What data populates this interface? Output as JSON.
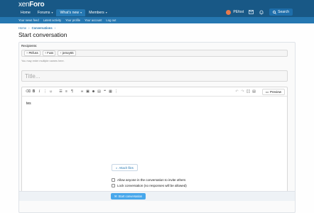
{
  "header": {
    "logo_main": "xen",
    "logo_bold": "Foro",
    "nav": [
      {
        "label": "Home"
      },
      {
        "label": "Forums"
      },
      {
        "label": "What's new"
      },
      {
        "label": "Members"
      }
    ],
    "user_name": "PEfost",
    "search_label": "Search"
  },
  "subnav": [
    "Your news feed",
    "Latest activity",
    "Your profile",
    "Your account",
    "Log out"
  ],
  "breadcrumb": {
    "home": "Home",
    "current": "Conversations"
  },
  "page_title": "Start conversation",
  "form": {
    "recipients_label": "Recipients:",
    "recipients": [
      "PEfuss",
      "Fuss",
      "jersey65"
    ],
    "recipients_hint": "You may enter multiple names here.",
    "title_placeholder": "Title...",
    "editor_text": "tes",
    "preview_label": "Preview",
    "attach_label": "Attach files",
    "option_invite": "Allow anyone in the conversation to invite others",
    "option_lock": "Lock conversation (no responses will be allowed)",
    "submit_label": "Start conversation"
  },
  "colors": {
    "header": "#185886",
    "subnav": "#2577b1",
    "link": "#2577b1",
    "button": "#47a7eb"
  }
}
